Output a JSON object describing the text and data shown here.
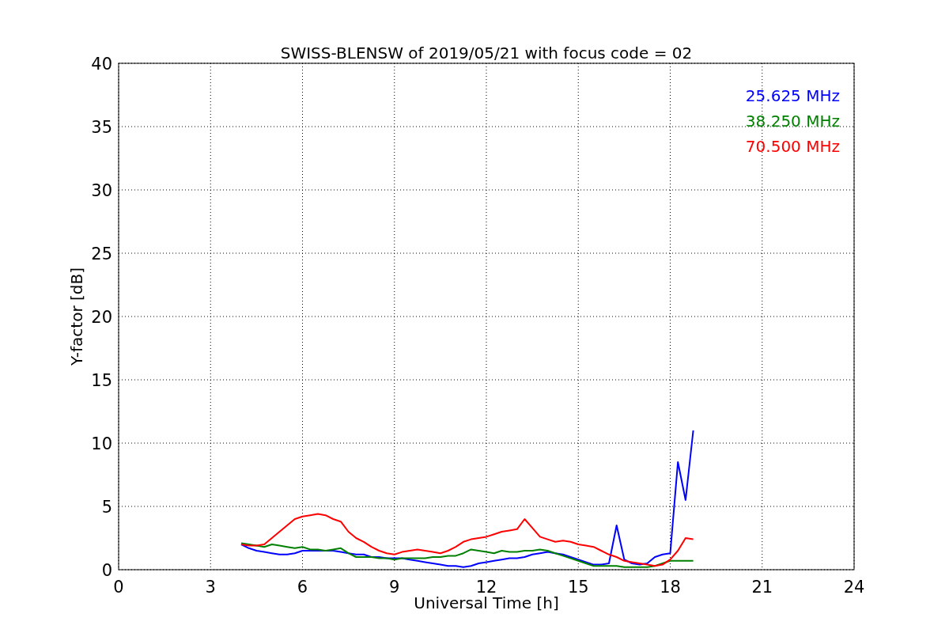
{
  "figure": {
    "chart_data": {
      "type": "line",
      "title": "SWISS-BLENSW of 2019/05/21 with focus code = 02",
      "xlabel": "Universal Time [h]",
      "ylabel": "Y-factor [dB]",
      "x": [
        4,
        4.25,
        4.5,
        4.75,
        5,
        5.25,
        5.5,
        5.75,
        6,
        6.25,
        6.5,
        6.75,
        7,
        7.25,
        7.5,
        7.75,
        8,
        8.25,
        8.5,
        8.75,
        9,
        9.25,
        9.5,
        9.75,
        10,
        10.25,
        10.5,
        10.75,
        11,
        11.25,
        11.5,
        11.75,
        12,
        12.25,
        12.5,
        12.75,
        13,
        13.25,
        13.5,
        13.75,
        14,
        14.25,
        14.5,
        14.75,
        15,
        15.25,
        15.5,
        15.75,
        16,
        16.25,
        16.5,
        16.75,
        17,
        17.25,
        17.5,
        17.75,
        18,
        18.25,
        18.5,
        18.75
      ],
      "series": [
        {
          "name": "25.625 MHz",
          "color": "#0000ff",
          "values": [
            2.0,
            1.7,
            1.5,
            1.4,
            1.3,
            1.2,
            1.2,
            1.3,
            1.5,
            1.5,
            1.5,
            1.5,
            1.5,
            1.4,
            1.3,
            1.2,
            1.2,
            1.0,
            1.0,
            0.9,
            0.9,
            0.9,
            0.8,
            0.7,
            0.6,
            0.5,
            0.4,
            0.3,
            0.3,
            0.2,
            0.3,
            0.5,
            0.6,
            0.7,
            0.8,
            0.9,
            0.9,
            1.0,
            1.2,
            1.3,
            1.4,
            1.3,
            1.2,
            1.0,
            0.8,
            0.6,
            0.4,
            0.4,
            0.5,
            3.5,
            0.8,
            0.5,
            0.4,
            0.5,
            1.0,
            1.2,
            1.3,
            8.5,
            5.5,
            11.0
          ]
        },
        {
          "name": "38.250 MHz",
          "color": "#008000",
          "values": [
            2.1,
            2.0,
            1.9,
            1.8,
            2.0,
            1.9,
            1.8,
            1.7,
            1.8,
            1.6,
            1.6,
            1.5,
            1.6,
            1.7,
            1.3,
            1.0,
            1.0,
            1.0,
            0.9,
            0.9,
            0.8,
            0.9,
            0.9,
            0.9,
            0.9,
            1.0,
            1.0,
            1.1,
            1.1,
            1.3,
            1.6,
            1.5,
            1.4,
            1.3,
            1.5,
            1.4,
            1.4,
            1.5,
            1.5,
            1.6,
            1.5,
            1.3,
            1.1,
            0.9,
            0.7,
            0.5,
            0.3,
            0.3,
            0.3,
            0.3,
            0.2,
            0.2,
            0.2,
            0.2,
            0.3,
            0.5,
            0.7,
            0.7,
            0.7,
            0.7
          ]
        },
        {
          "name": "70.500 MHz",
          "color": "#ff0000",
          "values": [
            2.0,
            1.9,
            1.9,
            2.0,
            2.5,
            3.0,
            3.5,
            4.0,
            4.2,
            4.3,
            4.4,
            4.3,
            4.0,
            3.8,
            3.0,
            2.5,
            2.2,
            1.8,
            1.5,
            1.3,
            1.2,
            1.4,
            1.5,
            1.6,
            1.5,
            1.4,
            1.3,
            1.5,
            1.8,
            2.2,
            2.4,
            2.5,
            2.6,
            2.8,
            3.0,
            3.1,
            3.2,
            4.0,
            3.3,
            2.6,
            2.4,
            2.2,
            2.3,
            2.2,
            2.0,
            1.9,
            1.8,
            1.5,
            1.2,
            1.0,
            0.7,
            0.6,
            0.5,
            0.4,
            0.3,
            0.4,
            0.8,
            1.5,
            2.5,
            2.4
          ]
        }
      ],
      "grid": true,
      "xlim": [
        0,
        24
      ],
      "ylim": [
        0,
        40
      ],
      "xticks": [
        0,
        3,
        6,
        9,
        12,
        15,
        18,
        21,
        24
      ],
      "yticks": [
        0,
        5,
        10,
        15,
        20,
        25,
        30,
        35,
        40
      ]
    }
  }
}
